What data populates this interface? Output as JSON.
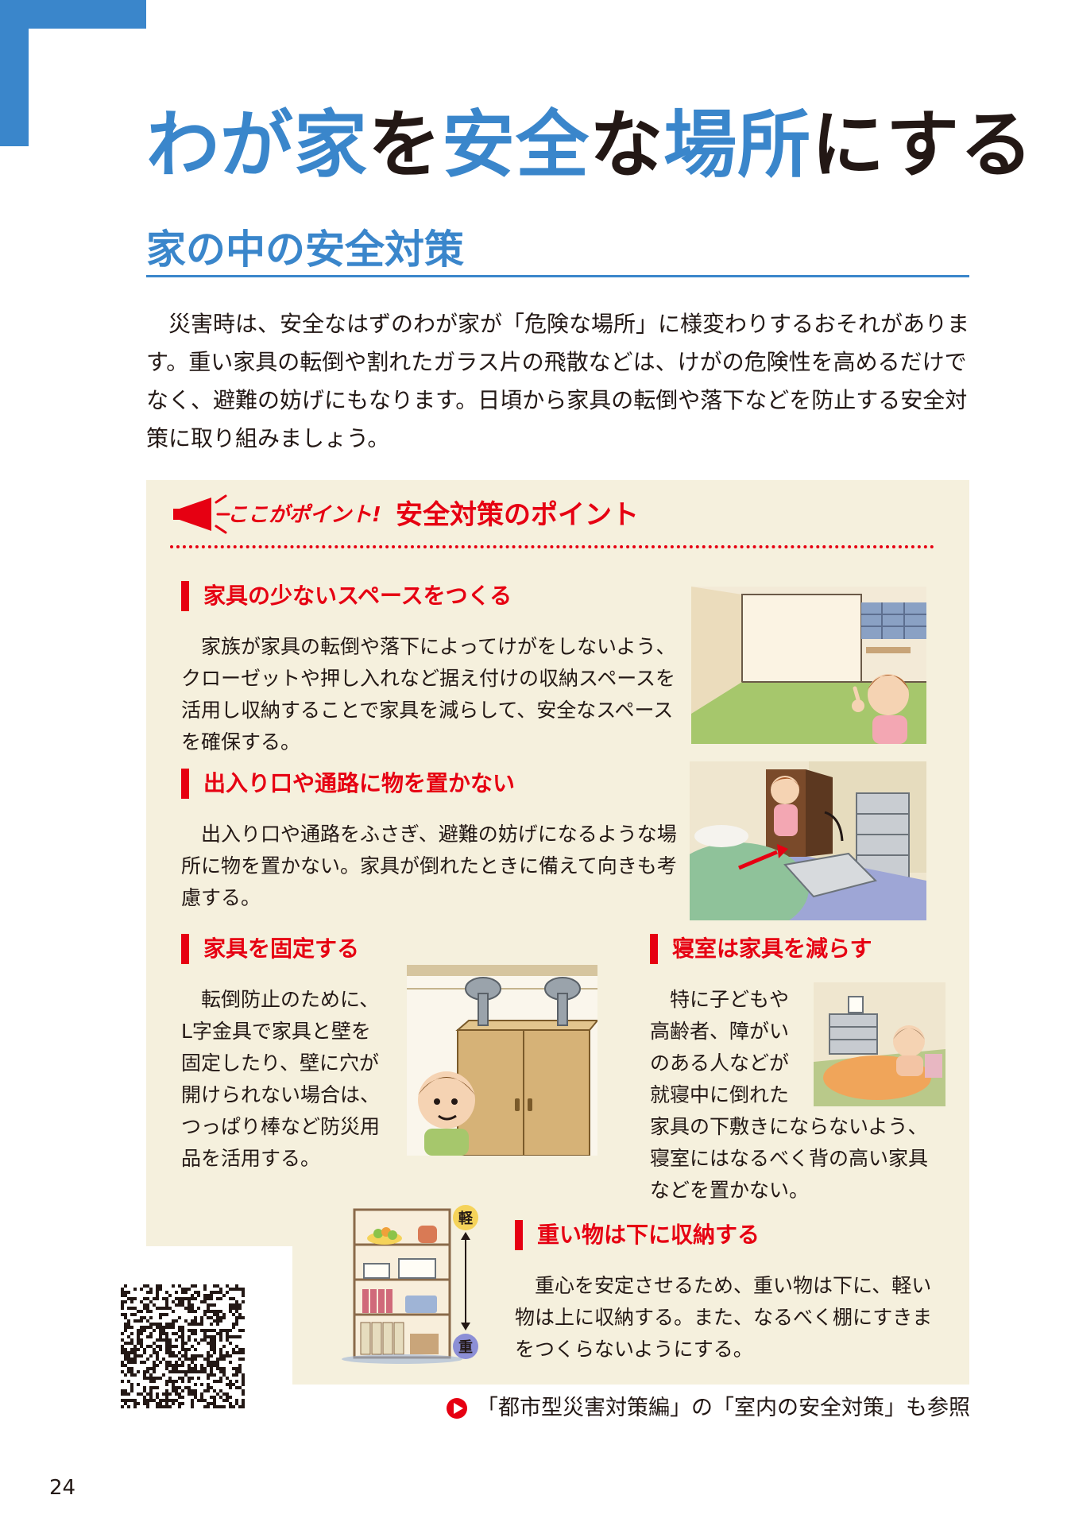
{
  "title": {
    "parts": [
      {
        "text": "わが",
        "tone": "blue"
      },
      {
        "text": "家",
        "tone": "blue"
      },
      {
        "text": "を",
        "tone": "dark"
      },
      {
        "text": "安全",
        "tone": "blue"
      },
      {
        "text": "な",
        "tone": "dark"
      },
      {
        "text": "場所",
        "tone": "blue"
      },
      {
        "text": "にする",
        "tone": "dark"
      }
    ]
  },
  "section": {
    "heading": "家の中の安全対策"
  },
  "intro": "災害時は、安全なはずのわが家が「危険な場所」に様変わりするおそれがあります。重い家具の転倒や割れたガラス片の飛散などは、けがの危険性を高めるだけでなく、避難の妨げにもなります。日頃から家具の転倒や落下などを防止する安全対策に取り組みましょう。",
  "points": {
    "badge": "ここがポイント!",
    "title": "安全対策のポイント",
    "items": [
      {
        "heading": "家具の少ないスペースをつくる",
        "body": "家族が家具の転倒や落下によってけがをしないよう、クローゼットや押し入れなど据え付けの収納スペースを活用し収納することで家具を減らして、安全なスペースを確保する。"
      },
      {
        "heading": "出入り口や通路に物を置かない",
        "body": "出入り口や通路をふさぎ、避難の妨げになるような場所に物を置かない。家具が倒れたときに備えて向きも考慮する。"
      },
      {
        "heading": "家具を固定する",
        "body": "転倒防止のために、L字金具で家具と壁を固定したり、壁に穴が開けられない場合は、つっぱり棒など防災用品を活用する。"
      },
      {
        "heading": "寝室は家具を減らす",
        "body_top": "特に子どもや高齢者、障がいのある人などが就寝中に倒れた",
        "body_bottom": "家具の下敷きにならないよう、寝室にはなるべく背の高い家具などを置かない。"
      },
      {
        "heading": "重い物は下に収納する",
        "body": "重心を安定させるため、重い物は下に、軽い物は上に収納する。また、なるべく棚にすきまをつくらないようにする。",
        "light_label": "軽",
        "heavy_label": "重"
      }
    ]
  },
  "note": "「都市型災害対策編」の「室内の安全対策」も参照",
  "page_number": "24",
  "colors": {
    "brand_blue": "#3a86cb",
    "accent_red": "#e60012",
    "panel_bg": "#f5f0dd",
    "text": "#231815"
  }
}
